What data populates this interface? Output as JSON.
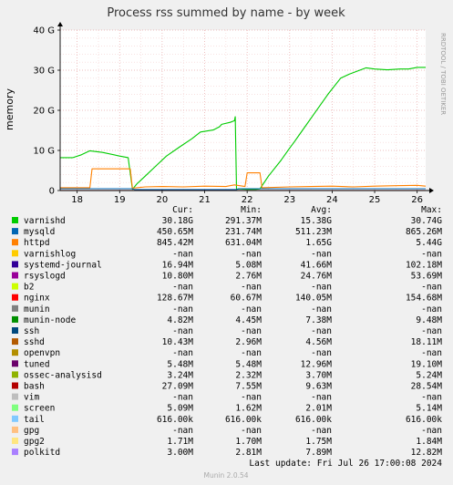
{
  "chart_data": {
    "type": "area",
    "title": "Process rss summed by name - by week",
    "ylabel": "memory",
    "side_label": "RRDTOOL / TOBI OETIKER",
    "ylim": [
      0,
      40
    ],
    "y_unit": "G",
    "y_ticks": [
      {
        "value": 0,
        "label": "0"
      },
      {
        "value": 10,
        "label": "10 G"
      },
      {
        "value": 20,
        "label": "20 G"
      },
      {
        "value": 30,
        "label": "30 G"
      },
      {
        "value": 40,
        "label": "40 G"
      }
    ],
    "x_range": [
      17.6,
      26.2
    ],
    "x_ticks": [
      {
        "value": 18,
        "label": "18"
      },
      {
        "value": 19,
        "label": "19"
      },
      {
        "value": 20,
        "label": "20"
      },
      {
        "value": 21,
        "label": "21"
      },
      {
        "value": 22,
        "label": "22"
      },
      {
        "value": 23,
        "label": "23"
      },
      {
        "value": 24,
        "label": "24"
      },
      {
        "value": 25,
        "label": "25"
      },
      {
        "value": 26,
        "label": "26"
      }
    ],
    "grid": true,
    "series": [
      {
        "name": "varnishd",
        "color": "#00cc00",
        "style": "line",
        "x": [
          17.6,
          17.9,
          18.1,
          18.3,
          18.6,
          19.0,
          19.2,
          19.3,
          19.4,
          19.6,
          19.9,
          20.1,
          20.4,
          20.7,
          20.9,
          21.2,
          21.35,
          21.4,
          21.6,
          21.7,
          21.72,
          21.75,
          21.8,
          22.0,
          22.2,
          22.3,
          22.5,
          22.8,
          23.0,
          23.1,
          23.3,
          23.6,
          23.9,
          24.2,
          24.4,
          24.6,
          24.8,
          25.0,
          25.3,
          25.6,
          25.8,
          26.0,
          26.2
        ],
        "values": [
          8.2,
          8.2,
          8.9,
          9.9,
          9.5,
          8.6,
          8.2,
          0.3,
          1.6,
          3.6,
          6.6,
          8.6,
          10.8,
          12.9,
          14.6,
          15.1,
          15.9,
          16.5,
          17.0,
          17.4,
          18.4,
          0.3,
          0.4,
          0.3,
          0.3,
          0.4,
          3.6,
          7.6,
          10.6,
          12.0,
          15.0,
          19.5,
          24.0,
          28.0,
          29.0,
          29.8,
          30.6,
          30.3,
          30.1,
          30.3,
          30.3,
          30.7,
          30.7
        ]
      },
      {
        "name": "httpd",
        "color": "#ff8000",
        "style": "line",
        "x": [
          17.6,
          18.3,
          18.35,
          19.25,
          19.3,
          19.6,
          20.0,
          20.5,
          21.0,
          21.5,
          21.7,
          21.95,
          22.0,
          22.3,
          22.35,
          23.0,
          23.5,
          24.0,
          24.5,
          25.0,
          25.5,
          26.0,
          26.2
        ],
        "values": [
          0.7,
          0.7,
          5.4,
          5.4,
          0.6,
          0.9,
          1.0,
          0.9,
          1.1,
          1.0,
          1.4,
          1.0,
          4.4,
          4.4,
          0.7,
          0.9,
          1.0,
          1.1,
          0.9,
          1.1,
          1.2,
          1.3,
          1.1
        ]
      },
      {
        "name": "mysqld",
        "color": "#0066b3",
        "style": "line",
        "x": [
          17.6,
          19.3,
          19.35,
          21.75,
          21.8,
          26.2
        ],
        "values": [
          0.45,
          0.45,
          0.25,
          0.25,
          0.45,
          0.45
        ]
      },
      {
        "name": "bash",
        "color": "#cc0000",
        "style": "line",
        "x": [
          17.6,
          26.2
        ],
        "values": [
          0.03,
          0.03
        ]
      }
    ],
    "legend_header": {
      "cur": "Cur:",
      "min": "Min:",
      "avg": "Avg:",
      "max": "Max:"
    },
    "legend": [
      {
        "name": "varnishd",
        "color": "#00cc00",
        "cur": "30.18G",
        "min": "291.37M",
        "avg": "15.38G",
        "max": "30.74G"
      },
      {
        "name": "mysqld",
        "color": "#0066b3",
        "cur": "450.65M",
        "min": "231.74M",
        "avg": "511.23M",
        "max": "865.26M"
      },
      {
        "name": "httpd",
        "color": "#ff8000",
        "cur": "845.42M",
        "min": "631.04M",
        "avg": "1.65G",
        "max": "5.44G"
      },
      {
        "name": "varnishlog",
        "color": "#ffcc00",
        "cur": "-nan",
        "min": "-nan",
        "avg": "-nan",
        "max": "-nan"
      },
      {
        "name": "systemd-journal",
        "color": "#330099",
        "cur": "16.94M",
        "min": "5.08M",
        "avg": "41.66M",
        "max": "102.18M"
      },
      {
        "name": "rsyslogd",
        "color": "#990099",
        "cur": "10.80M",
        "min": "2.76M",
        "avg": "24.76M",
        "max": "53.69M"
      },
      {
        "name": "b2",
        "color": "#ccff00",
        "cur": "-nan",
        "min": "-nan",
        "avg": "-nan",
        "max": "-nan"
      },
      {
        "name": "nginx",
        "color": "#ff0000",
        "cur": "128.67M",
        "min": "60.67M",
        "avg": "140.05M",
        "max": "154.68M"
      },
      {
        "name": "munin",
        "color": "#808080",
        "cur": "-nan",
        "min": "-nan",
        "avg": "-nan",
        "max": "-nan"
      },
      {
        "name": "munin-node",
        "color": "#008f00",
        "cur": "4.82M",
        "min": "4.45M",
        "avg": "7.38M",
        "max": "9.48M"
      },
      {
        "name": "ssh",
        "color": "#00487d",
        "cur": "-nan",
        "min": "-nan",
        "avg": "-nan",
        "max": "-nan"
      },
      {
        "name": "sshd",
        "color": "#b35a00",
        "cur": "10.43M",
        "min": "2.96M",
        "avg": "4.56M",
        "max": "18.11M"
      },
      {
        "name": "openvpn",
        "color": "#b38f00",
        "cur": "-nan",
        "min": "-nan",
        "avg": "-nan",
        "max": "-nan"
      },
      {
        "name": "tuned",
        "color": "#6b006b",
        "cur": "5.48M",
        "min": "5.48M",
        "avg": "12.96M",
        "max": "19.10M"
      },
      {
        "name": "ossec-analysisd",
        "color": "#8fb300",
        "cur": "3.24M",
        "min": "2.32M",
        "avg": "3.70M",
        "max": "5.24M"
      },
      {
        "name": "bash",
        "color": "#b30000",
        "cur": "27.09M",
        "min": "7.55M",
        "avg": "9.63M",
        "max": "28.54M"
      },
      {
        "name": "vim",
        "color": "#bebebe",
        "cur": "-nan",
        "min": "-nan",
        "avg": "-nan",
        "max": "-nan"
      },
      {
        "name": "screen",
        "color": "#80ff80",
        "cur": "5.09M",
        "min": "1.62M",
        "avg": "2.01M",
        "max": "5.14M"
      },
      {
        "name": "tail",
        "color": "#80c9ff",
        "cur": "616.00k",
        "min": "616.00k",
        "avg": "616.00k",
        "max": "616.00k"
      },
      {
        "name": "gpg",
        "color": "#ffc080",
        "cur": "-nan",
        "min": "-nan",
        "avg": "-nan",
        "max": "-nan"
      },
      {
        "name": "gpg2",
        "color": "#ffe680",
        "cur": "1.71M",
        "min": "1.70M",
        "avg": "1.75M",
        "max": "1.84M"
      },
      {
        "name": "polkitd",
        "color": "#aa80ff",
        "cur": "3.00M",
        "min": "2.81M",
        "avg": "7.89M",
        "max": "12.82M"
      }
    ],
    "last_update": "Last update: Fri Jul 26 17:00:08 2024",
    "version": "Munin 2.0.54"
  }
}
